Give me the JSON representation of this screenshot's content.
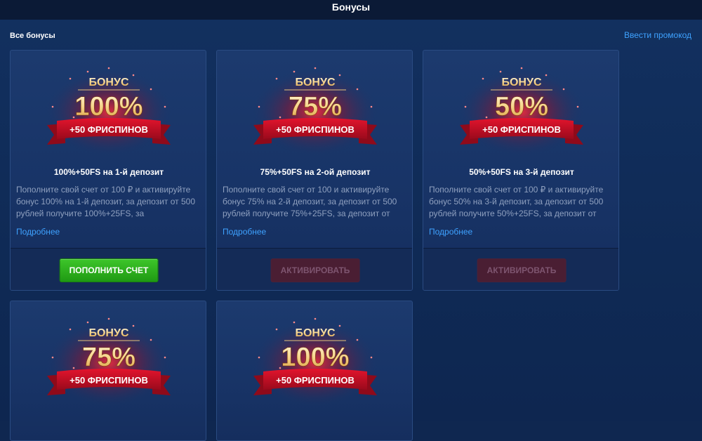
{
  "header": {
    "title": "Бонусы"
  },
  "section": {
    "title": "Все бонусы",
    "promo_link": "Ввести промокод"
  },
  "colors": {
    "accent_link": "#3ea2ff",
    "green_button": "#2db11d",
    "ribbon_red": "#c8102e",
    "gold_text": "#f5c879"
  },
  "cards": [
    {
      "badge_top": "БОНУС",
      "badge_percent": "100%",
      "badge_ribbon": "+50 ФРИСПИНОВ",
      "title": "100%+50FS на 1-й депозит",
      "description": "Пополните свой счет от 100 ₽ и активируйте бонус 100% на 1-й депозит, за депозит от 500 рублей получите 100%+25FS, за",
      "more": "Подробнее",
      "button": "ПОПОЛНИТЬ СЧЕТ",
      "button_state": "active"
    },
    {
      "badge_top": "БОНУС",
      "badge_percent": "75%",
      "badge_ribbon": "+50 ФРИСПИНОВ",
      "title": "75%+50FS на 2-ой депозит",
      "description": "Пополните свой счет от 100 и активируйте бонус 75% на 2-й депозит, за депозит от 500 рублей получите 75%+25FS, за депозит от",
      "more": "Подробнее",
      "button": "АКТИВИРОВАТЬ",
      "button_state": "disabled"
    },
    {
      "badge_top": "БОНУС",
      "badge_percent": "50%",
      "badge_ribbon": "+50 ФРИСПИНОВ",
      "title": "50%+50FS на 3-й депозит",
      "description": "Пополните свой счет от 100 ₽ и активируйте бонус 50% на 3-й депозит, за депозит от 500 рублей получите 50%+25FS, за депозит от",
      "more": "Подробнее",
      "button": "АКТИВИРОВАТЬ",
      "button_state": "disabled"
    },
    {
      "badge_top": "БОНУС",
      "badge_percent": "75%",
      "badge_ribbon": "+50 ФРИСПИНОВ"
    },
    {
      "badge_top": "БОНУС",
      "badge_percent": "100%",
      "badge_ribbon": "+50 ФРИСПИНОВ"
    }
  ]
}
